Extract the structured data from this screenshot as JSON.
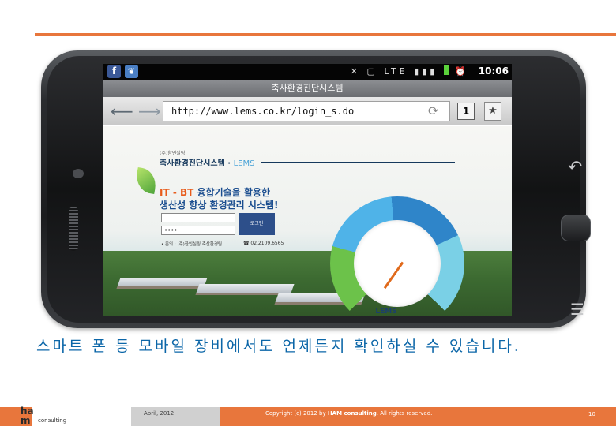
{
  "browser": {
    "page_title": "축사환경진단시스템",
    "url": "http://www.lems.co.kr/login_s.do",
    "tabs_count": "1",
    "clock": "10:06",
    "status_icons": "✕ ▢ LTE ▮▮▮"
  },
  "website": {
    "company": "(주)함인실링",
    "brand": "축사환경진단시스템 ·",
    "brand_sub": "LEMS",
    "slogan_line1_hl": "IT - BT",
    "slogan_line1": " 융합기술을 활용한",
    "slogan_line2": "생산성 향상 환경관리 시스템!",
    "password_value": "••••",
    "login_label": "로그인",
    "contact": "• 문의 : (주)한인실링 축산환경팀",
    "phone": "☎ 02.2109.6565",
    "gauge_label": "LEMS"
  },
  "caption": "스마트 폰 등 모바일 장비에서도 언제든지 확인하실 수 있습니다.",
  "footer": {
    "logo_ha": "ha",
    "logo_m": "m",
    "logo_consulting": "consulting",
    "date": "April, 2012",
    "copyright_prefix": "Copyright (c) 2012 by ",
    "copyright_brand": "HAM consulting",
    "copyright_suffix": ". All rights reserved.",
    "page_sep": "|",
    "page_number": "10"
  },
  "colors": {
    "accent_orange": "#e8763c",
    "caption_blue": "#0b66a8"
  }
}
